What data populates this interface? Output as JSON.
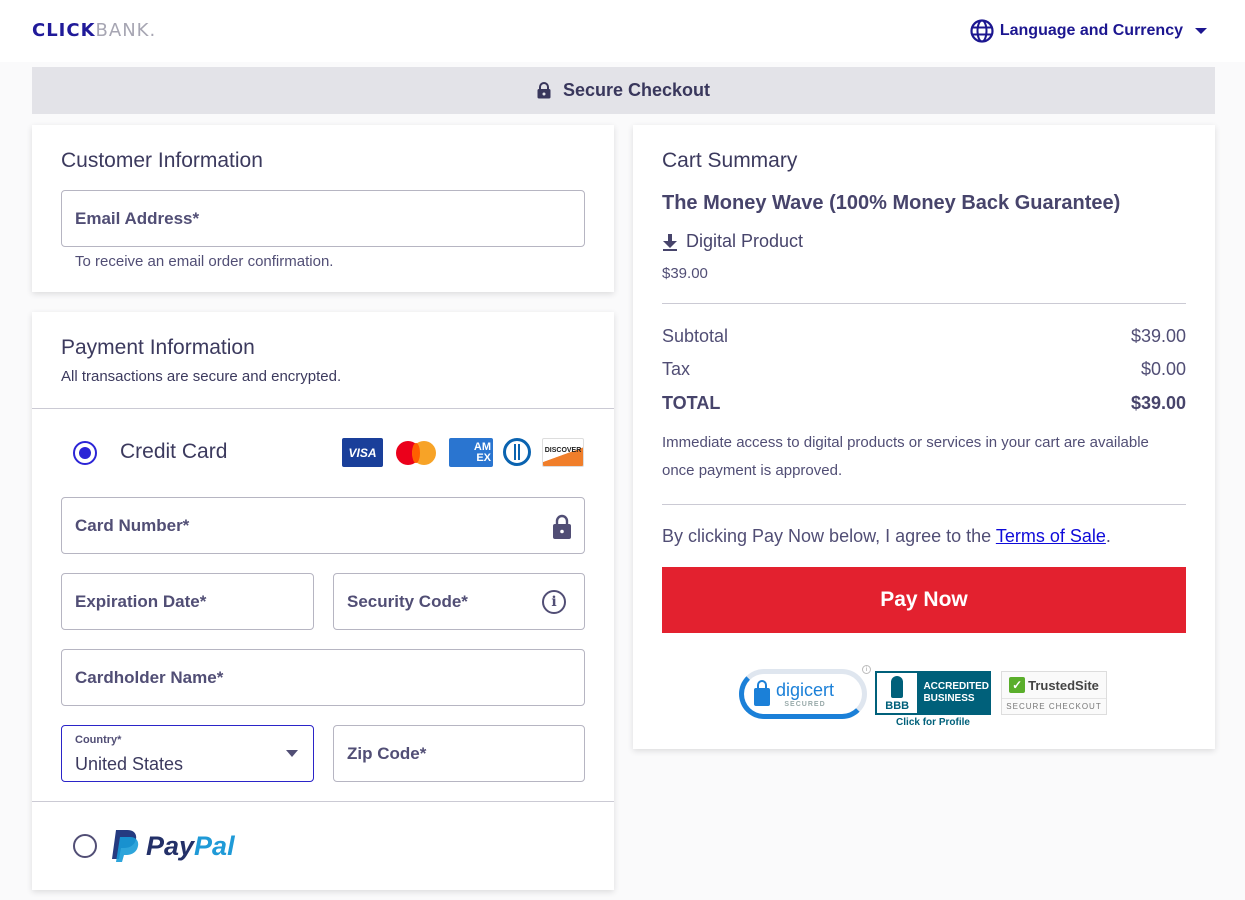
{
  "header": {
    "logo_click": "CLICK",
    "logo_bank": "BANK",
    "logo_mark": ".",
    "language_currency_label": "Language and Currency"
  },
  "secure_bar": {
    "label": "Secure Checkout"
  },
  "customer": {
    "title": "Customer Information",
    "email_label": "Email Address*",
    "email_hint": "To receive an email order confirmation."
  },
  "payment": {
    "title": "Payment Information",
    "subtitle": "All transactions are secure and encrypted.",
    "methods": {
      "credit_card": {
        "label": "Credit Card",
        "selected": true
      },
      "paypal": {
        "label_pay": "Pay",
        "label_pal": "Pal",
        "selected": false
      }
    },
    "card_brands": {
      "visa": "VISA",
      "amex_top": "AM",
      "amex_bottom": "EX",
      "discover": "DISCOVER"
    },
    "fields": {
      "card_number": "Card Number*",
      "expiration": "Expiration Date*",
      "security_code": "Security Code*",
      "cardholder": "Cardholder Name*",
      "country_label": "Country*",
      "country_value": "United States",
      "zip": "Zip Code*"
    }
  },
  "cart": {
    "title": "Cart Summary",
    "product_name": "The Money Wave (100% Money Back Guarantee)",
    "product_type": "Digital Product",
    "product_price": "$39.00",
    "rows": [
      {
        "label": "Subtotal",
        "value": "$39.00"
      },
      {
        "label": "Tax",
        "value": "$0.00"
      },
      {
        "label": "TOTAL",
        "value": "$39.00"
      }
    ],
    "notice": "Immediate access to digital products or services in your cart are available once payment is approved.",
    "agree_prefix": "By clicking Pay Now below, I agree to the ",
    "terms_link": "Terms of Sale",
    "agree_suffix": ".",
    "pay_button": "Pay Now"
  },
  "badges": {
    "digicert": "digicert",
    "digicert_sub": "SECURED",
    "bbb_logo": "BBB",
    "bbb_line1": "ACCREDITED",
    "bbb_line2": "BUSINESS",
    "bbb_caption": "Click for Profile",
    "trusted_site": "TrustedSite",
    "trusted_sub": "SECURE CHECKOUT"
  },
  "colors": {
    "brand_blue": "#201a99",
    "pay_red": "#e3212f",
    "radio_selected": "#2b24d6",
    "link": "#0f0bd9"
  }
}
